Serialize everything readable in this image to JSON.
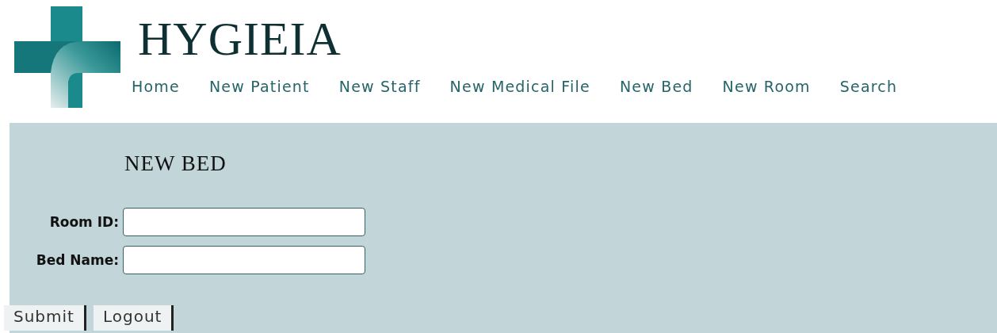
{
  "brand": {
    "title": "HYGIEIA"
  },
  "nav": [
    {
      "label": "Home"
    },
    {
      "label": "New Patient"
    },
    {
      "label": "New Staff"
    },
    {
      "label": "New Medical File"
    },
    {
      "label": "New Bed"
    },
    {
      "label": "New Room"
    },
    {
      "label": "Search"
    }
  ],
  "form": {
    "title": "NEW BED",
    "fields": [
      {
        "label": "Room ID:"
      },
      {
        "label": "Bed Name:"
      }
    ],
    "buttons": [
      "Submit",
      "Logout"
    ]
  }
}
